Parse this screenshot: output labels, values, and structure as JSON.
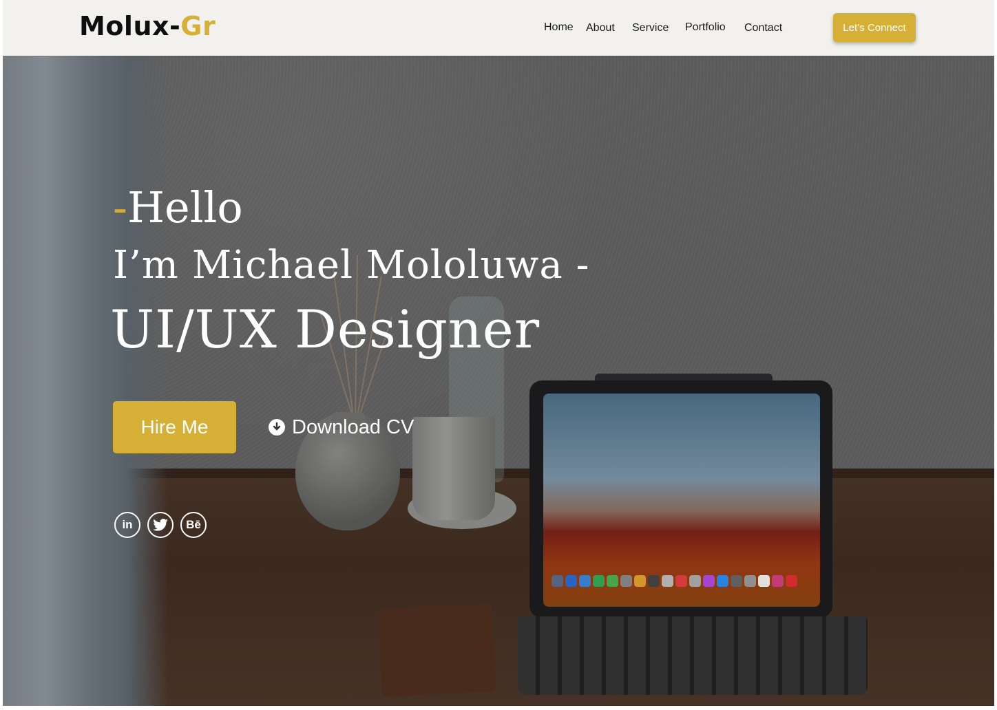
{
  "header": {
    "logo_main": "Molux-",
    "logo_accent": "Gr",
    "nav": [
      {
        "label": "Home"
      },
      {
        "label": "About"
      },
      {
        "label": "Service"
      },
      {
        "label": "Portfolio"
      },
      {
        "label": "Contact"
      }
    ],
    "cta_label": "Let’s Connect"
  },
  "hero": {
    "hello_dash": "-",
    "hello_text": "Hello",
    "intro": "I’m Michael Mololuwa -",
    "role": "UI/UX Designer",
    "hire_label": "Hire Me",
    "download_label": "Download CV",
    "socials": [
      {
        "icon": "linkedin-icon",
        "text": "in"
      },
      {
        "icon": "twitter-icon",
        "text": ""
      },
      {
        "icon": "behance-icon",
        "text": "Bē"
      }
    ]
  },
  "colors": {
    "accent": "#d6af37",
    "header_bg": "#f2f1ee",
    "text_dark": "#0e0e0e",
    "text_light": "#ffffff"
  }
}
